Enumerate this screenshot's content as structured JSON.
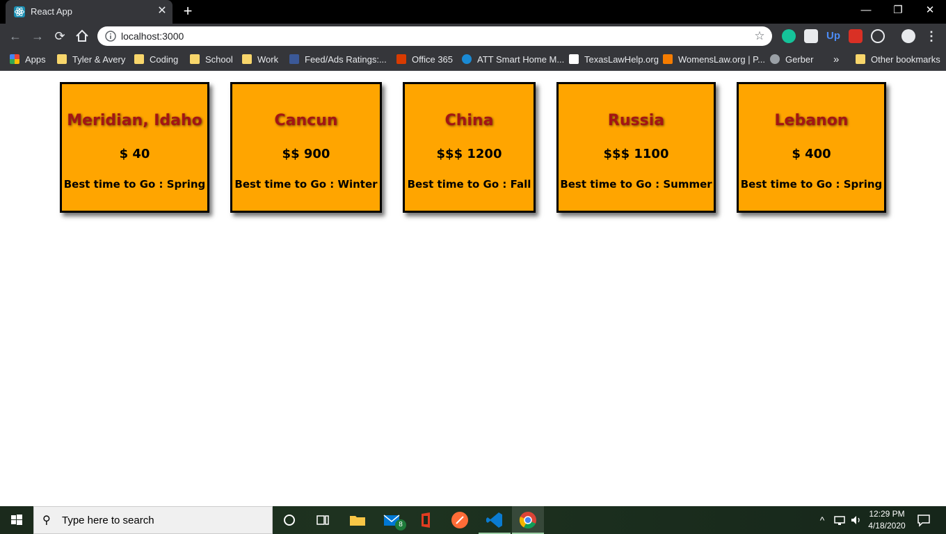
{
  "browser": {
    "tab_title": "React App",
    "tab_close": "✕",
    "new_tab": "+",
    "url": "localhost:3000",
    "window_controls": {
      "minimize": "—",
      "restore": "❐",
      "close": "✕"
    }
  },
  "bookmarks": [
    {
      "label": "Apps",
      "icon": "apps-grid-icon"
    },
    {
      "label": "Tyler & Avery",
      "icon": "folder-icon"
    },
    {
      "label": "Coding",
      "icon": "folder-icon"
    },
    {
      "label": "School",
      "icon": "folder-icon"
    },
    {
      "label": "Work",
      "icon": "folder-icon"
    },
    {
      "label": "Feed/Ads Ratings:...",
      "icon": "facebook-icon"
    },
    {
      "label": "Office 365",
      "icon": "office-icon"
    },
    {
      "label": "ATT Smart Home M...",
      "icon": "att-icon"
    },
    {
      "label": "TexasLawHelp.org",
      "icon": "texaslawhelp-icon"
    },
    {
      "label": "WomensLaw.org | P...",
      "icon": "home-icon"
    },
    {
      "label": "Gerber",
      "icon": "gerber-icon"
    },
    {
      "label": "»",
      "icon": ""
    },
    {
      "label": "Other bookmarks",
      "icon": "folder-icon"
    }
  ],
  "destinations": [
    {
      "city": "Meridian, Idaho",
      "price": "$ 40",
      "best": "Best time to Go : Spring"
    },
    {
      "city": "Cancun",
      "price": "$$ 900",
      "best": "Best time to Go : Winter"
    },
    {
      "city": "China",
      "price": "$$$ 1200",
      "best": "Best time to Go : Fall"
    },
    {
      "city": "Russia",
      "price": "$$$ 1100",
      "best": "Best time to Go : Summer"
    },
    {
      "city": "Lebanon",
      "price": "$ 400",
      "best": "Best time to Go : Spring"
    }
  ],
  "taskbar": {
    "search_placeholder": "Type here to search",
    "mail_badge": "8",
    "time": "12:29 PM",
    "date": "4/18/2020"
  },
  "colors": {
    "card_bg": "#ffa500",
    "card_title": "#a31515",
    "chrome_dark": "#35363a"
  }
}
